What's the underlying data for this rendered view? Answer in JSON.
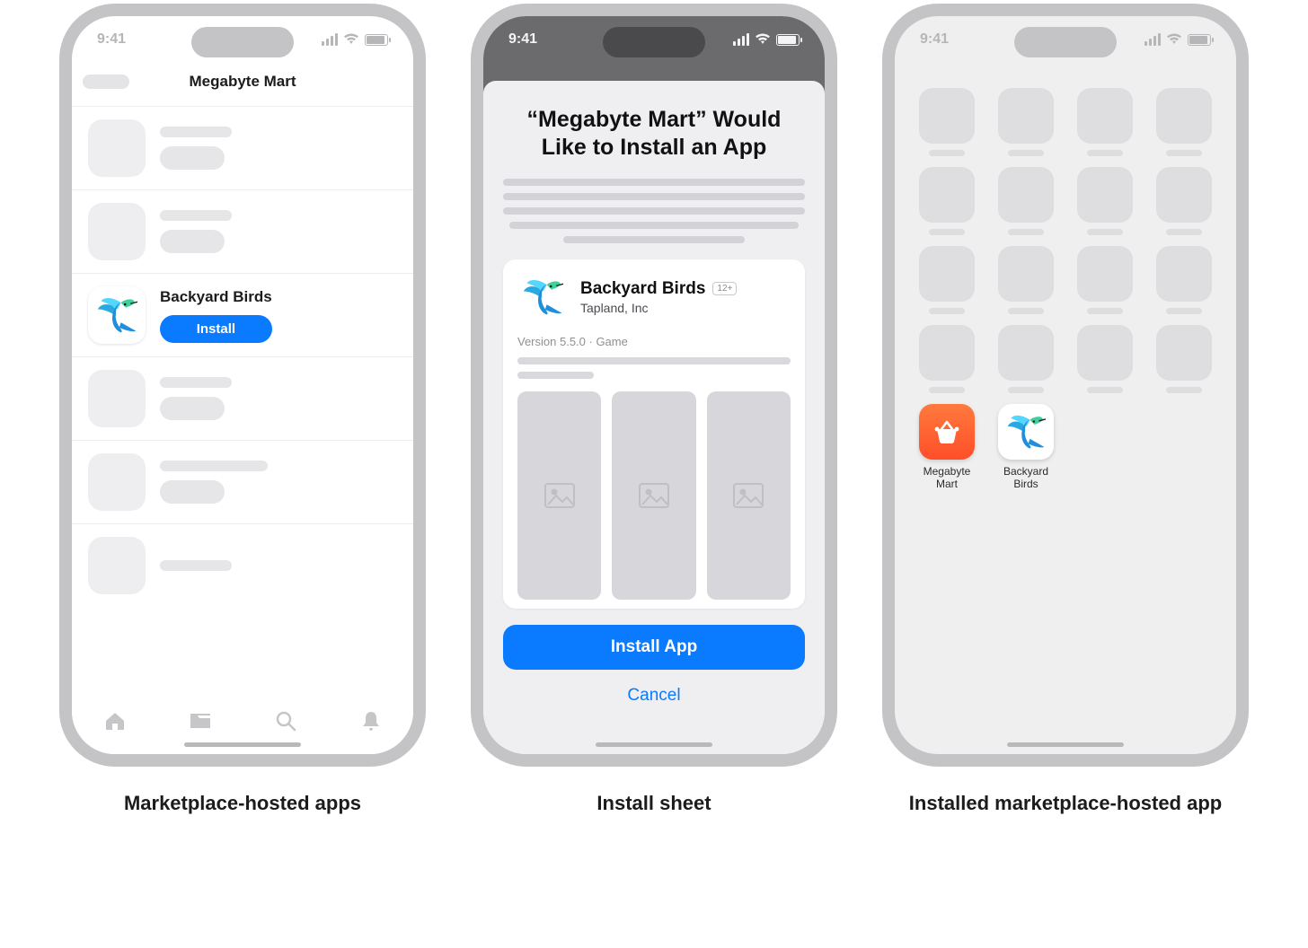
{
  "status": {
    "time": "9:41"
  },
  "device": {
    "signal_bars": 4,
    "wifi_full": true,
    "battery_full": true
  },
  "phoneA": {
    "nav_title": "Megabyte Mart",
    "app_name": "Backyard Birds",
    "install_label": "Install",
    "placeholder_rows": 5,
    "tabs": [
      "home",
      "folder",
      "search",
      "bell"
    ]
  },
  "phoneB": {
    "sheet_title": "“Megabyte Mart” Would Like to Install an App",
    "app_name": "Backyard Birds",
    "developer": "Tapland, Inc",
    "age_rating": "12+",
    "meta": "Version 5.5.0 · Game",
    "install_label": "Install App",
    "cancel_label": "Cancel",
    "screenshot_count": 3
  },
  "phoneC": {
    "placeholder_icons": 16,
    "grid_columns": 4,
    "apps": [
      {
        "id": "megabyte-mart",
        "label": "Megabyte Mart"
      },
      {
        "id": "backyard-birds",
        "label": "Backyard Birds"
      }
    ]
  },
  "captions": {
    "a": "Marketplace-hosted apps",
    "b": "Install sheet",
    "c": "Installed marketplace-hosted app"
  }
}
